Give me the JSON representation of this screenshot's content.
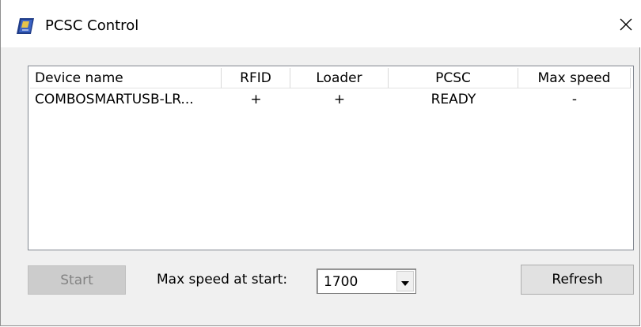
{
  "window": {
    "title": "PCSC Control",
    "close_icon": "close-icon",
    "app_icon": "card-reader-icon"
  },
  "device_list": {
    "columns": [
      "Device name",
      "RFID",
      "Loader",
      "PCSC",
      "Max speed"
    ],
    "rows": [
      [
        "COMBOSMARTUSB-LR...",
        "+",
        "+",
        "READY",
        "-"
      ]
    ]
  },
  "controls": {
    "start_label": "Start",
    "speed_label": "Max speed at start:",
    "speed_value": "1700",
    "refresh_label": "Refresh"
  },
  "colors": {
    "window_bg": "#f0f0f0",
    "list_bg": "#ffffff",
    "disabled_text": "#838383"
  }
}
